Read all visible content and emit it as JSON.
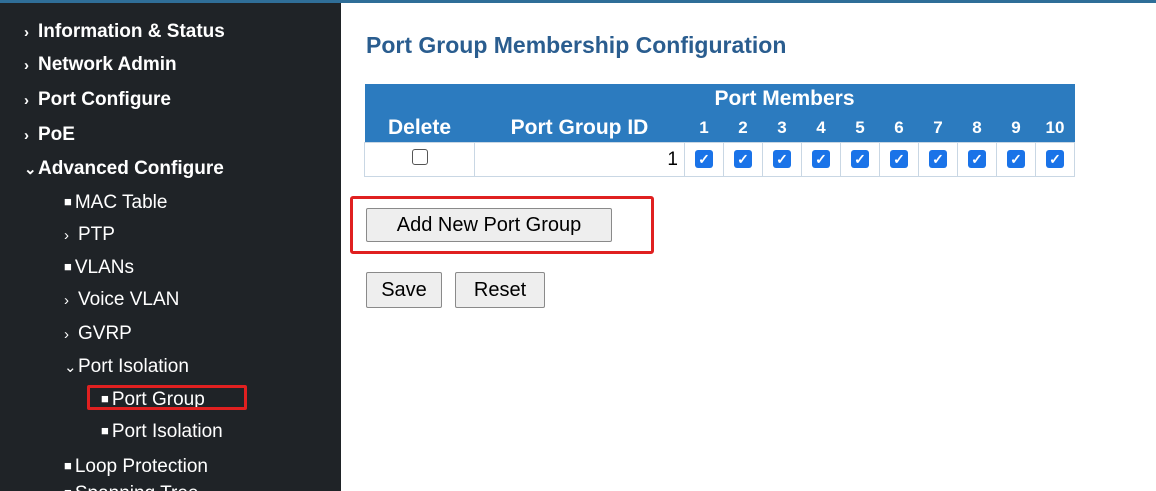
{
  "sidebar": {
    "items": [
      {
        "label": "Information & Status"
      },
      {
        "label": "Network Admin"
      },
      {
        "label": "Port Configure"
      },
      {
        "label": "PoE"
      },
      {
        "label": "Advanced Configure"
      },
      {
        "label": "MAC Table"
      },
      {
        "label": "PTP"
      },
      {
        "label": "VLANs"
      },
      {
        "label": "Voice VLAN"
      },
      {
        "label": "GVRP"
      },
      {
        "label": "Port Isolation"
      },
      {
        "label": "Port Group"
      },
      {
        "label": "Port Isolation"
      },
      {
        "label": "Loop Protection"
      },
      {
        "label": "Spanning Tree"
      }
    ]
  },
  "main": {
    "title": "Port Group Membership Configuration",
    "table": {
      "header_members": "Port Members",
      "header_delete": "Delete",
      "header_group_id": "Port Group ID",
      "ports": [
        "1",
        "2",
        "3",
        "4",
        "5",
        "6",
        "7",
        "8",
        "9",
        "10"
      ],
      "rows": [
        {
          "delete": false,
          "group_id": "1",
          "members": [
            true,
            true,
            true,
            true,
            true,
            true,
            true,
            true,
            true,
            true
          ]
        }
      ]
    },
    "add_button": "Add New Port Group",
    "save_button": "Save",
    "reset_button": "Reset"
  },
  "colors": {
    "sidebar_bg": "#1f2327",
    "header_bg": "#2c7bbf",
    "title": "#2a5d8f",
    "highlight": "#e02020",
    "checkbox": "#1a73e8"
  }
}
